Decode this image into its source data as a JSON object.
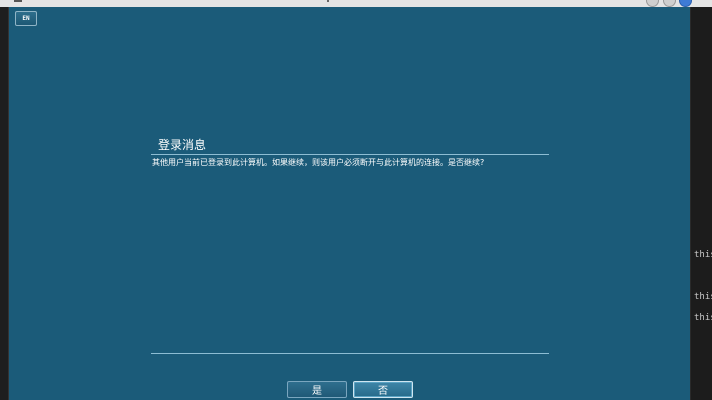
{
  "toolbar": {
    "language_button": "EN"
  },
  "dialog": {
    "title": "登录消息",
    "message": "其他用户当前已登录到此计算机。如果继续，则该用户必须断开与此计算机的连接。是否继续?",
    "yes_label": "是",
    "no_label": "否"
  },
  "terminal": {
    "lines": [
      "this",
      "this",
      "this"
    ]
  },
  "colors": {
    "viewer_background": "#1b5b79",
    "rule": "#8dbdd3",
    "text": "#ffffff"
  }
}
